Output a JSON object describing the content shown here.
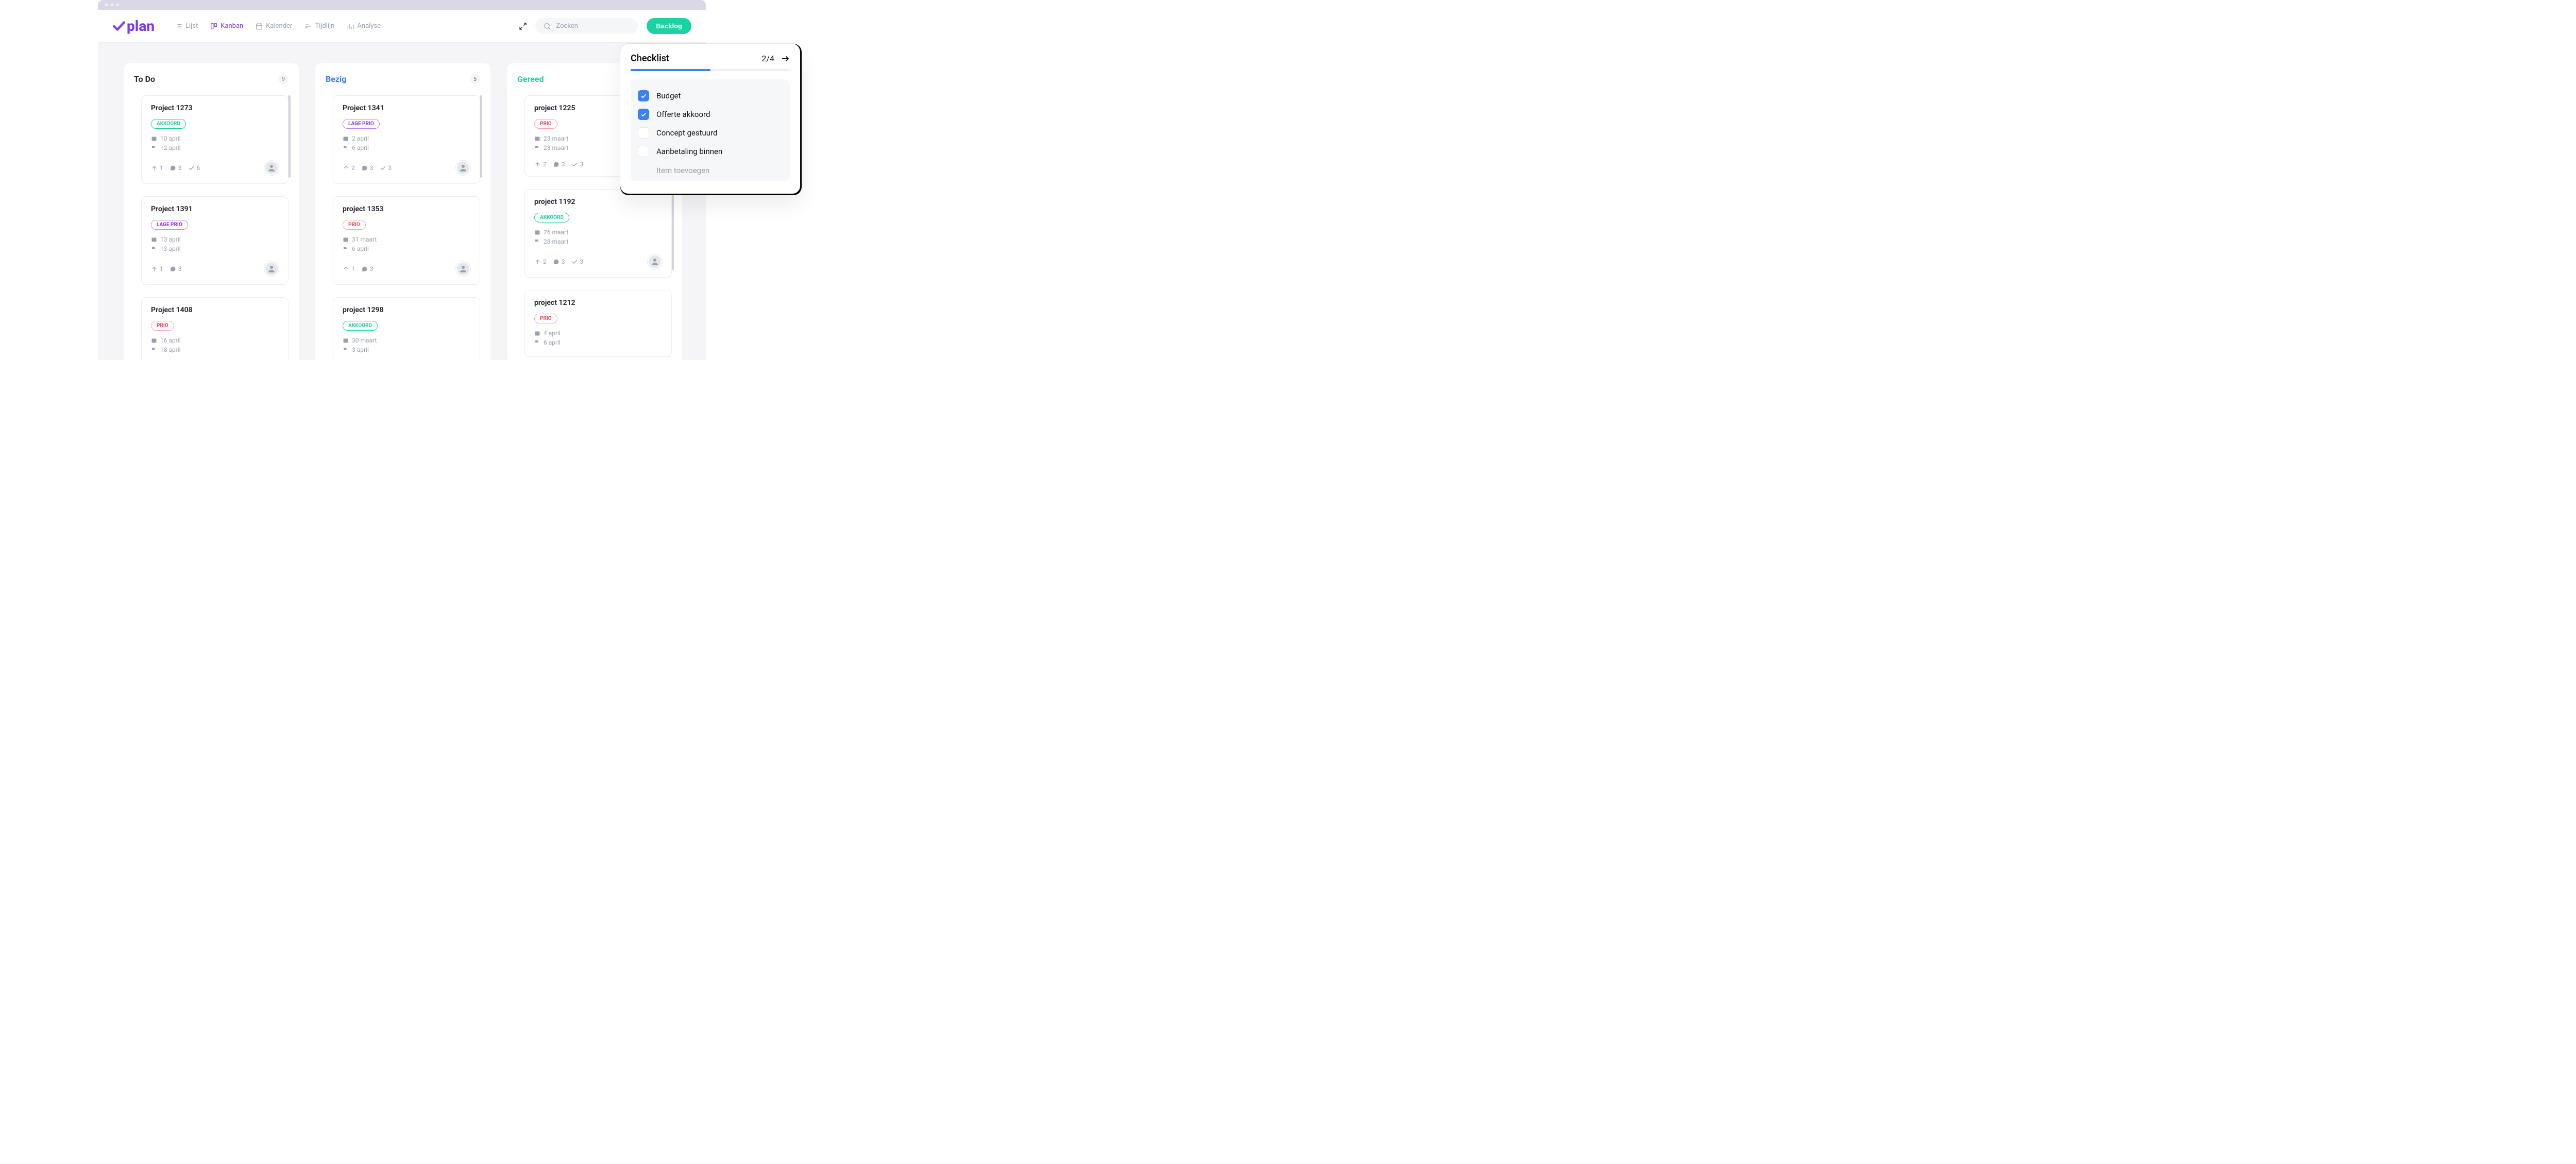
{
  "brand": "plan",
  "nav": {
    "lijst": "Lijst",
    "kanban": "Kanban",
    "kalender": "Kalender",
    "tijdlijn": "Tijdlijn",
    "analyse": "Analyse"
  },
  "search": {
    "placeholder": "Zoeken"
  },
  "backlog_label": "Backlog",
  "columns": {
    "todo": {
      "title": "To Do",
      "count": "9"
    },
    "bezig": {
      "title": "Bezig",
      "count": "5"
    },
    "gereed": {
      "title": "Gereed",
      "count": ""
    }
  },
  "cards": {
    "todo": [
      {
        "title": "Project 1273",
        "tag": "AKKOORD",
        "tag_type": "akkoord",
        "date1": "10 april",
        "date2": "12 april",
        "s1": "1",
        "s2": "3",
        "s3": "6",
        "avatar": true
      },
      {
        "title": "Project 1391",
        "tag": "LAGE PRIO",
        "tag_type": "lageprio",
        "date1": "13 april",
        "date2": "13 april",
        "s1": "1",
        "s2": "3",
        "s3": "",
        "avatar": true
      },
      {
        "title": "Project 1408",
        "tag": "PRIO",
        "tag_type": "prio",
        "date1": "16 april",
        "date2": "18 april",
        "s1": "",
        "s2": "",
        "s3": "",
        "avatar": false
      }
    ],
    "bezig": [
      {
        "title": "Project 1341",
        "tag": "LAGE PRIO",
        "tag_type": "lageprio",
        "date1": "2 april",
        "date2": "6 april",
        "s1": "2",
        "s2": "3",
        "s3": "3",
        "avatar": true
      },
      {
        "title": "project 1353",
        "tag": "PRIO",
        "tag_type": "prio",
        "date1": "31 maart",
        "date2": "6 april",
        "s1": "1",
        "s2": "3",
        "s3": "",
        "avatar": true
      },
      {
        "title": "project 1298",
        "tag": "AKKOORD",
        "tag_type": "akkoord",
        "date1": "30 maart",
        "date2": "3 april",
        "s1": "",
        "s2": "",
        "s3": "",
        "avatar": false
      }
    ],
    "gereed": [
      {
        "title": "project 1225",
        "tag": "PRIO",
        "tag_type": "prio",
        "date1": "23 maart",
        "date2": "23 maart",
        "s1": "2",
        "s2": "3",
        "s3": "3",
        "avatar": false
      },
      {
        "title": "project 1192",
        "tag": "AKKOORD",
        "tag_type": "akkoord",
        "date1": "26 maart",
        "date2": "28 maart",
        "s1": "2",
        "s2": "3",
        "s3": "3",
        "avatar": true
      },
      {
        "title": "project 1212",
        "tag": "PRIO",
        "tag_type": "prio",
        "date1": "4 april",
        "date2": "6 april",
        "s1": "",
        "s2": "",
        "s3": "",
        "avatar": false
      }
    ]
  },
  "checklist": {
    "title": "Checklist",
    "progress_text": "2/4",
    "progress_pct": 50,
    "items": [
      {
        "label": "Budget",
        "checked": true
      },
      {
        "label": "Offerte akkoord",
        "checked": true
      },
      {
        "label": "Concept gestuurd",
        "checked": false
      },
      {
        "label": "Aanbetaling binnen",
        "checked": false
      }
    ],
    "add_placeholder": "Item toevoegen"
  }
}
